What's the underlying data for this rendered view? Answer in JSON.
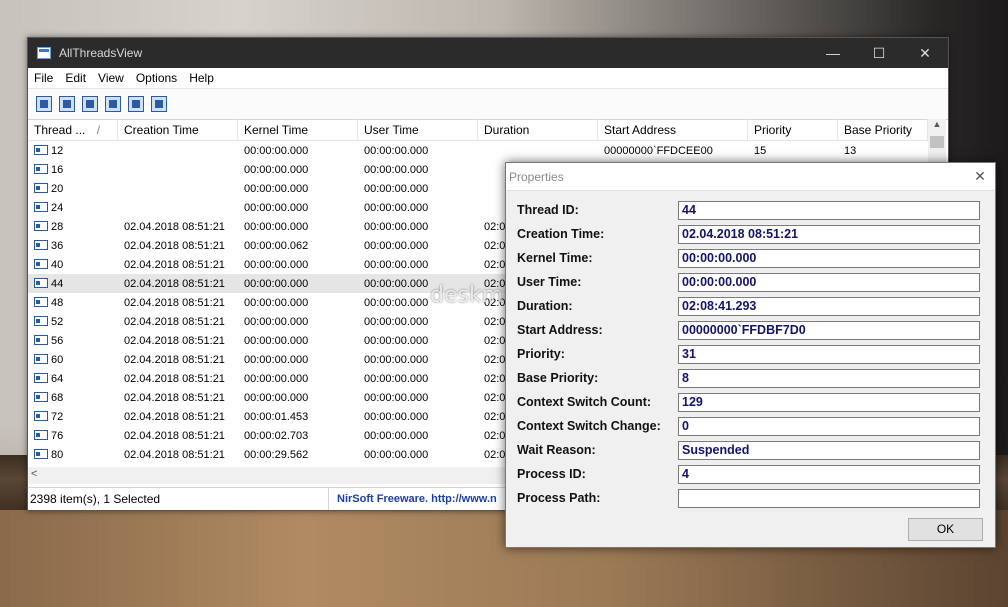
{
  "window": {
    "title": "AllThreadsView",
    "minimize": "—",
    "maximize": "☐",
    "close": "✕",
    "menu": [
      "File",
      "Edit",
      "View",
      "Options",
      "Help"
    ],
    "toolbar_icons": [
      "save-icon",
      "refresh-icon",
      "copy-icon",
      "properties-icon",
      "find-icon",
      "exit-icon"
    ]
  },
  "table": {
    "columns": [
      "Thread ...",
      "Creation Time",
      "Kernel Time",
      "User Time",
      "Duration",
      "Start Address",
      "Priority",
      "Base Priority"
    ],
    "sort_indicator": "/",
    "rows": [
      [
        "12",
        "",
        "00:00:00.000",
        "00:00:00.000",
        "",
        "00000000`FFDCEE00",
        "15",
        "13"
      ],
      [
        "16",
        "",
        "00:00:00.000",
        "00:00:00.000",
        "",
        "",
        "",
        ""
      ],
      [
        "20",
        "",
        "00:00:00.000",
        "00:00:00.000",
        "",
        "",
        "",
        ""
      ],
      [
        "24",
        "",
        "00:00:00.000",
        "00:00:00.000",
        "",
        "",
        "",
        ""
      ],
      [
        "28",
        "02.04.2018 08:51:21",
        "00:00:00.000",
        "00:00:00.000",
        "02:0",
        "",
        "",
        ""
      ],
      [
        "36",
        "02.04.2018 08:51:21",
        "00:00:00.062",
        "00:00:00.000",
        "02:0",
        "",
        "",
        ""
      ],
      [
        "40",
        "02.04.2018 08:51:21",
        "00:00:00.000",
        "00:00:00.000",
        "02:0",
        "",
        "",
        ""
      ],
      [
        "44",
        "02.04.2018 08:51:21",
        "00:00:00.000",
        "00:00:00.000",
        "02:0",
        "",
        "",
        ""
      ],
      [
        "48",
        "02.04.2018 08:51:21",
        "00:00:00.000",
        "00:00:00.000",
        "02:0",
        "",
        "",
        ""
      ],
      [
        "52",
        "02.04.2018 08:51:21",
        "00:00:00.000",
        "00:00:00.000",
        "02:0",
        "",
        "",
        ""
      ],
      [
        "56",
        "02.04.2018 08:51:21",
        "00:00:00.000",
        "00:00:00.000",
        "02:0",
        "",
        "",
        ""
      ],
      [
        "60",
        "02.04.2018 08:51:21",
        "00:00:00.000",
        "00:00:00.000",
        "02:0",
        "",
        "",
        ""
      ],
      [
        "64",
        "02.04.2018 08:51:21",
        "00:00:00.000",
        "00:00:00.000",
        "02:0",
        "",
        "",
        ""
      ],
      [
        "68",
        "02.04.2018 08:51:21",
        "00:00:00.000",
        "00:00:00.000",
        "02:0",
        "",
        "",
        ""
      ],
      [
        "72",
        "02.04.2018 08:51:21",
        "00:00:01.453",
        "00:00:00.000",
        "02:0",
        "",
        "",
        ""
      ],
      [
        "76",
        "02.04.2018 08:51:21",
        "00:00:02.703",
        "00:00:00.000",
        "02:0",
        "",
        "",
        ""
      ],
      [
        "80",
        "02.04.2018 08:51:21",
        "00:00:29.562",
        "00:00:00.000",
        "02:0",
        "",
        "",
        ""
      ]
    ],
    "selected_row": 7
  },
  "status": {
    "items": "2398 item(s), 1 Selected",
    "credit": "NirSoft Freeware.  http://www.n"
  },
  "dialog": {
    "title": "Properties",
    "close": "✕",
    "fields": [
      {
        "label": "Thread ID:",
        "value": "44"
      },
      {
        "label": "Creation Time:",
        "value": "02.04.2018 08:51:21"
      },
      {
        "label": "Kernel Time:",
        "value": "00:00:00.000"
      },
      {
        "label": "User Time:",
        "value": "00:00:00.000"
      },
      {
        "label": "Duration:",
        "value": "02:08:41.293"
      },
      {
        "label": "Start Address:",
        "value": "00000000`FFDBF7D0"
      },
      {
        "label": "Priority:",
        "value": "31"
      },
      {
        "label": "Base Priority:",
        "value": "8"
      },
      {
        "label": "Context Switch Count:",
        "value": "129"
      },
      {
        "label": "Context Switch Change:",
        "value": "0"
      },
      {
        "label": "Wait Reason:",
        "value": "Suspended"
      },
      {
        "label": "Process ID:",
        "value": "4"
      },
      {
        "label": "Process Path:",
        "value": ""
      }
    ],
    "ok": "OK"
  },
  "watermark": "deskmodder.de"
}
